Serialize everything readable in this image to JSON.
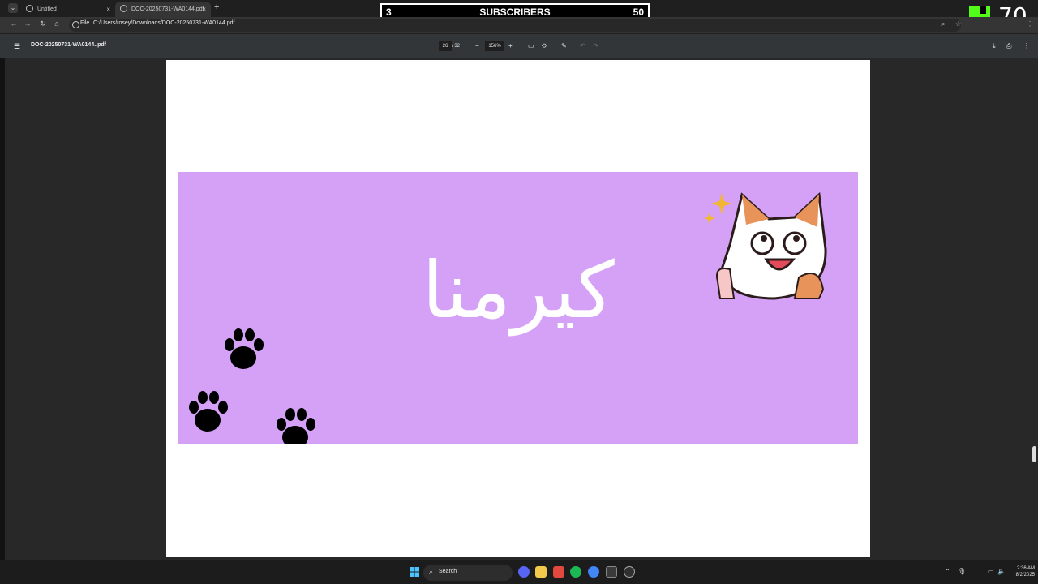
{
  "browser": {
    "tabs": [
      {
        "label": "Untitled",
        "active": false
      },
      {
        "label": "DOC-20250731-WA0144.pdf",
        "active": true
      }
    ],
    "close_symbol": "×",
    "new_tab_symbol": "+",
    "address": {
      "scheme_label": "File",
      "url": "C:/Users/rosey/Downloads/DOC-20250731-WA0144.pdf"
    }
  },
  "overlay": {
    "subscriber_counter": {
      "left_value": "3",
      "label": "SUBSCRIBERS",
      "right_value": "50"
    },
    "kick_counter": {
      "value": "70",
      "brand_color": "#53fc18"
    }
  },
  "pdf_toolbar": {
    "document_title": "DOC-20250731-WA0144..pdf",
    "page_current": "26",
    "page_total": "/ 32",
    "zoom": "156%",
    "zoom_out": "−",
    "zoom_in": "+"
  },
  "document": {
    "banner_text": "كيرمنا",
    "banner_color": "#d4a1f7",
    "page_color": "#ffffff"
  },
  "taskbar": {
    "search_label": "Search",
    "time": "2:36 AM",
    "date": "8/2/2025"
  },
  "icons": [
    "menu-icon",
    "back-icon",
    "forward-icon",
    "reload-icon",
    "home-icon",
    "info-icon",
    "zoom-icon",
    "star-icon",
    "download-icon",
    "more-icon",
    "fit-page-icon",
    "rotate-icon",
    "annotate-icon",
    "undo-icon",
    "redo-icon",
    "print-icon",
    "windows-icon",
    "search-icon"
  ]
}
